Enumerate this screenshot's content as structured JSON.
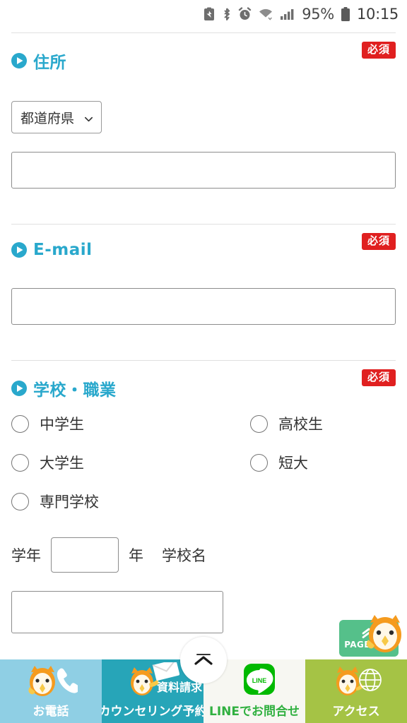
{
  "statusbar": {
    "icons": [
      "battery-saver-icon",
      "bluetooth-icon",
      "alarm-icon",
      "wifi-icon",
      "signal-icon"
    ],
    "battery_percent": "95%",
    "battery_icon": "battery-icon",
    "clock": "10:15"
  },
  "sections": {
    "address": {
      "title": "住所",
      "required_badge": "必須",
      "prefecture_select": "都道府県",
      "address_input_value": "",
      "address_input_placeholder": ""
    },
    "email": {
      "title": "E-mail",
      "required_badge": "必須",
      "email_input_value": "",
      "email_input_placeholder": ""
    },
    "school": {
      "title": "学校・職業",
      "required_badge": "必須",
      "options": [
        {
          "label": "中学生",
          "checked": false
        },
        {
          "label": "高校生",
          "checked": false
        },
        {
          "label": "大学生",
          "checked": false
        },
        {
          "label": "短大",
          "checked": false
        },
        {
          "label": "専門学校",
          "checked": false
        }
      ],
      "grade_label": "学年",
      "grade_value": "",
      "grade_unit": "年",
      "school_name_label": "学校名",
      "school_name_value": ""
    }
  },
  "page_top": {
    "label": "PAGE TOP",
    "icon": "double-chevron-up-icon",
    "mascot": "owl-mascot"
  },
  "scroll_top_fab": {
    "icon": "chevron-up-icon"
  },
  "bottom_nav": [
    {
      "label": "お電話",
      "icon": "owl-phone-icon",
      "bg": "#8FCFE4"
    },
    {
      "label": "カウンセリング予約",
      "secondary_label": "資料請求",
      "icon": "owl-mail-icon",
      "bg": "#27A5B8"
    },
    {
      "label": "LINEでお問合せ",
      "icon": "line-icon",
      "bg": "#F7F7F2"
    },
    {
      "label": "アクセス",
      "icon": "owl-globe-icon",
      "bg": "#A5C345"
    }
  ],
  "colors": {
    "heading_cyan": "#29A8CC",
    "required_red": "#E02020",
    "page_top_green": "#55C08A",
    "line_green": "#30B040",
    "nav_light_blue": "#8FCFE4",
    "nav_teal": "#27A5B8",
    "nav_olive": "#A5C345"
  }
}
